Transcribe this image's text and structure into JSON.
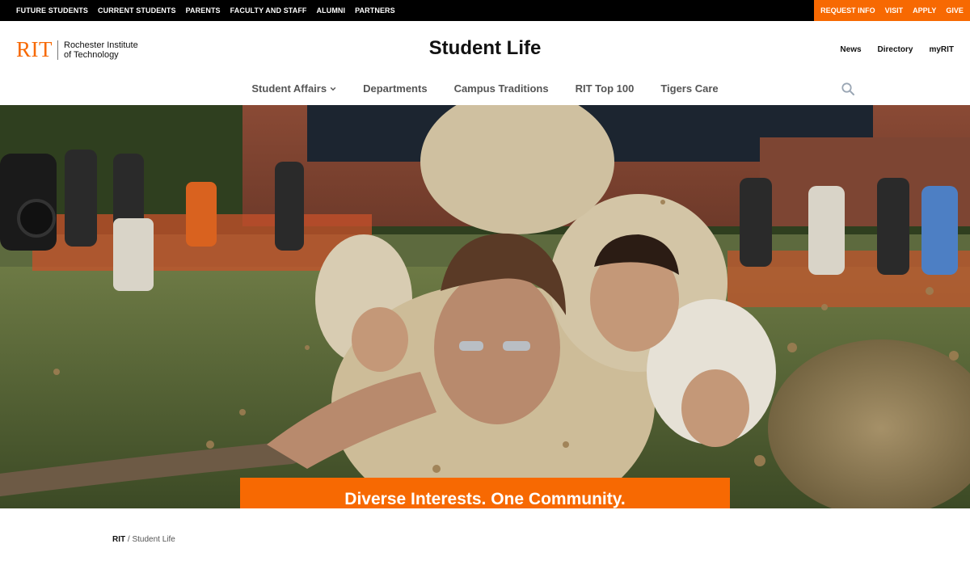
{
  "utility": {
    "left_links": [
      "FUTURE STUDENTS",
      "CURRENT STUDENTS",
      "PARENTS",
      "FACULTY AND STAFF",
      "ALUMNI",
      "PARTNERS"
    ],
    "right_links": [
      "REQUEST INFO",
      "VISIT",
      "APPLY",
      "GIVE"
    ],
    "accent_color": "#f76902"
  },
  "header": {
    "logo_mark": "RIT",
    "logo_line1": "Rochester Institute",
    "logo_line2": "of Technology",
    "site_title": "Student Life",
    "links": [
      "News",
      "Directory",
      "myRIT"
    ]
  },
  "nav": {
    "items": [
      "Student Affairs",
      "Departments",
      "Campus Traditions",
      "RIT Top 100",
      "Tigers Care"
    ],
    "search_icon": "search-icon",
    "dropdown_icon": "chevron-down-icon"
  },
  "hero": {
    "banner_text": "Diverse Interests. One Community."
  },
  "breadcrumb": {
    "root": "RIT",
    "separator": " / ",
    "current": "Student Life"
  }
}
